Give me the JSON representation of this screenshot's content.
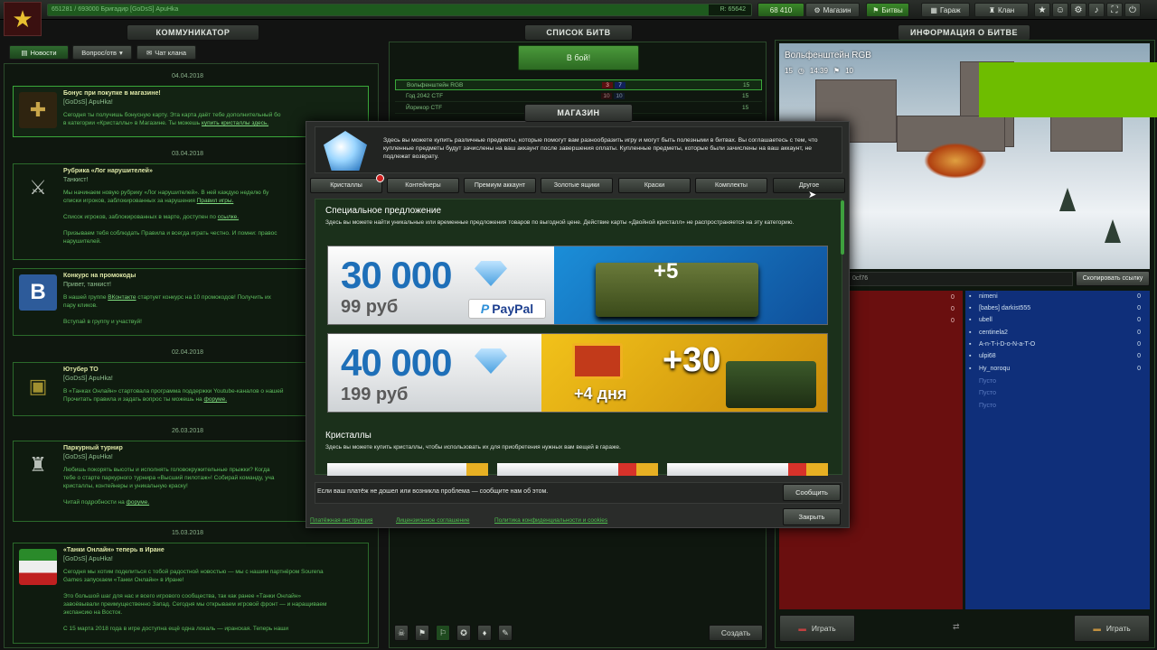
{
  "topbar": {
    "xp_text": "651281 / 693000   Бригадир [GoDsS] ApuHka",
    "xp_right": "R: 65642",
    "xp_fraction": 0.94,
    "crystals": "68 410",
    "shop_label": "Магазин",
    "battles_label": "Битвы",
    "garage_label": "Гараж",
    "clan_label": "Клан"
  },
  "communicator": {
    "title": "КОММУНИКАТОР",
    "tabs": [
      "Новости",
      "Вопрос/отв",
      "Чат клана"
    ],
    "news": [
      {
        "date": "04.04.2018",
        "title": "Бонус при покупке в магазине!",
        "author": "[GoDsS] ApuHka!",
        "body": "Сегодня ты получишь бонусную карту. Эта карта даёт тебе дополнительный бо",
        "body2": "в категории «Кристаллы» в Магазине. Ты можешь",
        "link": "купить кристаллы здесь."
      },
      {
        "date": "03.04.2018",
        "title": "Рубрика «Лог нарушителей»",
        "author": "Танкист!",
        "body": "Мы начинаем новую рубрику «Лог нарушителей». В ней каждую неделю бу",
        "body2": "списки игроков, заблокированных за нарушения",
        "link": "Правил игры.",
        "body3": "Список игроков, заблокированных в марте, доступен по",
        "link3": "ссылке.",
        "body4": "Призываем тебя соблюдать Правила и всегда играть честно. И помни: правос",
        "body5": "нарушителей."
      },
      {
        "title": "Конкурс на промокоды",
        "author": "Привет, танкист!",
        "body": "В нашей группе",
        "link": "ВКонтакте",
        "body2": "стартует конкурс на 10 промокодов! Получить их",
        "body3": "пару кликов.",
        "body4": "Вступай в группу и участвуй!"
      },
      {
        "date": "02.04.2018",
        "title": "Ютубер ТО",
        "author": "[GoDsS] ApuHka!",
        "body": "В «Танках Онлайн» стартовала программа поддержки Youtube-каналов о нашей",
        "body2": "Прочитать правила и задать вопрос ты можешь на",
        "link": "форуме."
      },
      {
        "date": "26.03.2018",
        "title": "Паркурный турнир",
        "author": "[GoDsS] ApuHka!",
        "body": "Любишь покорять высоты и исполнять головокружительные прыжки? Когда",
        "body2": "тебе о старте паркурного турнира «Высший пилотаж»! Собирай команду, уча",
        "body3": "кристаллы, контейнеры и уникальную краску!",
        "body4": "Читай подробности на",
        "link": "форуме."
      },
      {
        "date": "15.03.2018",
        "title": "«Танки Онлайн» теперь в Иране",
        "author": "[GoDsS] ApuHka!",
        "body": "Сегодня мы хотим поделиться с тобой радостной новостью — мы с нашим партнёром Sourena",
        "body2": "Games запускаем «Танки Онлайн» в Иране!",
        "body3": "Это большой шаг для нас и всего игрового сообщества, так как ранее «Танки Онлайн»",
        "body4": "завоёвывали преимущественно Запад. Сегодня мы открываем игровой фронт — и наращиваем",
        "body5": "экспансию на Восток.",
        "body6": "С 15 марта 2018 года в игре доступна ещё одна локаль — иранская. Теперь наши"
      }
    ]
  },
  "battle_list": {
    "title": "СПИСОК БИТВ",
    "go_button": "В бой!",
    "rows": [
      {
        "name": "Вольфенштейн RGB",
        "red": "3",
        "blue": "7",
        "max": "15"
      },
      {
        "name": "Год 2042 CTF",
        "red": "10",
        "blue": "10",
        "max": "15"
      },
      {
        "name": "Йорикор CTF",
        "red": "",
        "blue": "",
        "max": "15"
      },
      {
        "name": "",
        "red": "",
        "blue": "",
        "max": "15"
      }
    ],
    "create_label": "Создать"
  },
  "battle_info": {
    "title": "ИНФОРМАЦИЯ О БИТВЕ",
    "map_name": "Вольфенштейн RGB",
    "players_count": "15",
    "time": "14:39",
    "score": "10",
    "link_text": "0cf76",
    "copy_link": "Скопировать ссылку",
    "red_scores": [
      "0",
      "0",
      "0"
    ],
    "blue_team": [
      {
        "name": "nimeni",
        "score": "0"
      },
      {
        "name": "[babes] darkist555",
        "score": "0"
      },
      {
        "name": "ubell",
        "score": "0"
      },
      {
        "name": "centinela2",
        "score": "0"
      },
      {
        "name": "A-n-T-i-D-o-N-a-T-O",
        "score": "0"
      },
      {
        "name": "ulpi68",
        "score": "0"
      },
      {
        "name": "Hy_noroqu",
        "score": "0"
      },
      {
        "name": "Пусто",
        "score": ""
      },
      {
        "name": "Пусто",
        "score": ""
      },
      {
        "name": "Пусто",
        "score": ""
      }
    ],
    "play_red": "Играть",
    "play_blue": "Играть"
  },
  "shop": {
    "title": "МАГАЗИН",
    "intro": "Здесь вы можете купить различные предметы, которые помогут вам разнообразить игру и могут быть полезными в битвах. Вы соглашаетесь с тем, что купленные предметы будут зачислены на ваш аккаунт после завершения оплаты. Купленные предметы, которые были зачислены на ваш аккаунт, не подлежат возврату.",
    "tabs": [
      "Кристаллы",
      "Контейнеры",
      "Премиум аккаунт",
      "Золотые ящики",
      "Краски",
      "Комплекты",
      "Другое"
    ],
    "special": {
      "heading": "Специальное предложение",
      "desc": "Здесь вы можете найти уникальные или временные предложения товаров по выгодной цене. Действие карты «Двойной кристалл» не распространяется на эту категорию."
    },
    "offers": [
      {
        "amount": "30 000",
        "price": "99 руб",
        "bonus": "+5",
        "paypal": "PayPal"
      },
      {
        "amount": "40 000",
        "price": "199 руб",
        "bonus": "+30",
        "bonus2": "+4 дня"
      }
    ],
    "crystals_section": {
      "heading": "Кристаллы",
      "desc": "Здесь вы можете купить кристаллы, чтобы использовать их для приобретения нужных вам вещей в гараже."
    },
    "footer_text": "Если ваш платёж не дошел или возникла проблема — сообщите нам об этом.",
    "report_button": "Сообщить",
    "close_button": "Закрыть",
    "links": [
      "Платёжная инструкция",
      "Лицензионное соглашение",
      "Политика конфиденциальности и cookies"
    ]
  },
  "colors": {
    "accent_green": "#3aa83a",
    "blue_team_bg": "#0f2f7a",
    "red_team_bg": "#7a1010",
    "green_block": "#6ebd00"
  }
}
